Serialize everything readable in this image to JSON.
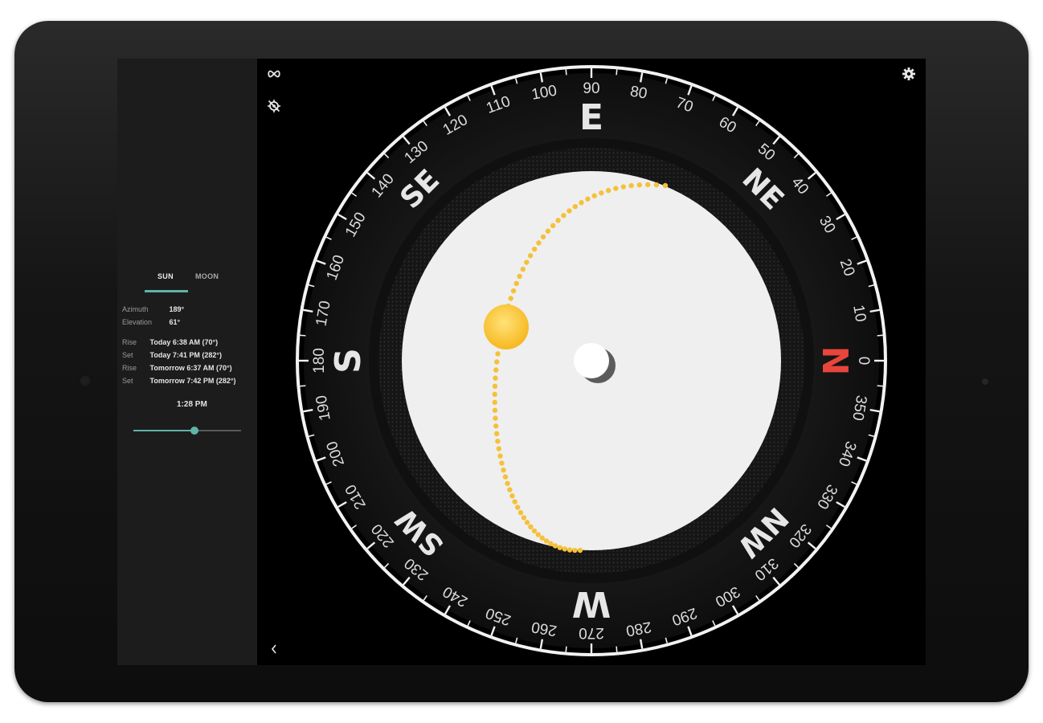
{
  "tabs": {
    "sun": "SUN",
    "moon": "MOON"
  },
  "sun_info": {
    "azimuth_label": "Azimuth",
    "azimuth_value": "189°",
    "elevation_label": "Elevation",
    "elevation_value": "61°"
  },
  "events": [
    {
      "label": "Rise",
      "value": "Today 6:38 AM (70°)"
    },
    {
      "label": "Set",
      "value": "Today 7:41 PM (282°)"
    },
    {
      "label": "Rise",
      "value": "Tomorrow 6:37 AM (70°)"
    },
    {
      "label": "Set",
      "value": "Tomorrow 7:42 PM (282°)"
    }
  ],
  "time": {
    "label": "1:28 PM",
    "slider_fraction": 0.57
  },
  "compass": {
    "cardinals": [
      {
        "text": "N",
        "deg": 0,
        "color": "#e8453c"
      },
      {
        "text": "NE",
        "deg": 45,
        "color": "#e6e6e6"
      },
      {
        "text": "E",
        "deg": 90,
        "color": "#e6e6e6"
      },
      {
        "text": "SE",
        "deg": 135,
        "color": "#e6e6e6"
      },
      {
        "text": "S",
        "deg": 180,
        "color": "#e6e6e6"
      },
      {
        "text": "SW",
        "deg": 225,
        "color": "#e6e6e6"
      },
      {
        "text": "W",
        "deg": 270,
        "color": "#e6e6e6"
      },
      {
        "text": "NW",
        "deg": 315,
        "color": "#e6e6e6"
      }
    ],
    "degree_labels": [
      "0",
      "10",
      "20",
      "30",
      "40",
      "50",
      "60",
      "70",
      "80",
      "90",
      "100",
      "110",
      "120",
      "130",
      "140",
      "150",
      "160",
      "170",
      "180",
      "190",
      "200",
      "210",
      "220",
      "230",
      "240",
      "250",
      "260",
      "270",
      "280",
      "290",
      "300",
      "310",
      "320",
      "330",
      "340",
      "350"
    ]
  },
  "colors": {
    "accent": "#5fb3a8",
    "sun": "#fbc02d",
    "sun_path": "#f5c13b",
    "north": "#e8453c"
  },
  "icons": {
    "top_left_1": "infinity-icon",
    "top_left_2": "location-off-icon",
    "top_right": "gear-icon",
    "bottom_left": "chevron-left-icon"
  }
}
